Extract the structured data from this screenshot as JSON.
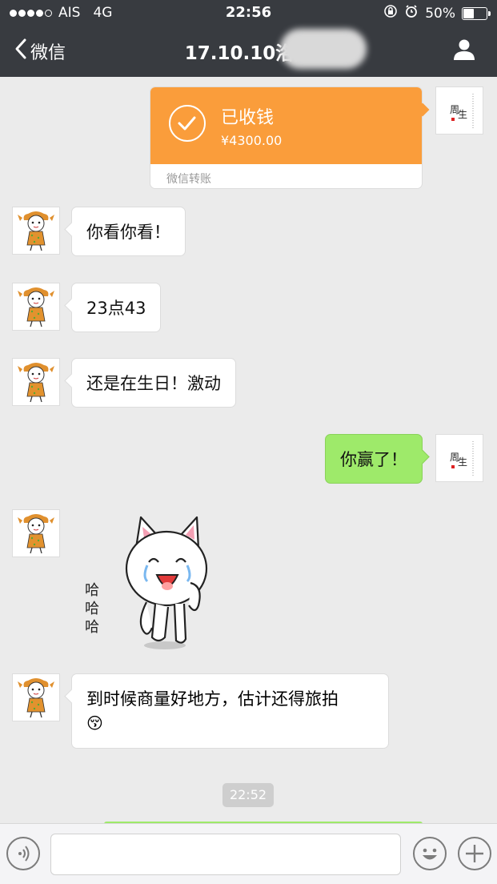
{
  "status_bar": {
    "carrier": "AIS",
    "network": "4G",
    "time": "22:56",
    "battery": "50%",
    "battery_level": 0.5
  },
  "nav": {
    "back_label": "微信",
    "title": "17.10.10洛阳",
    "back_icon": "chevron-left-icon",
    "profile_icon": "person-icon"
  },
  "messages": {
    "transfer": {
      "status": "已收钱",
      "amount": "¥4300.00",
      "footer": "微信转账",
      "color": "#fa9d3b"
    },
    "m1": "你看你看！",
    "m2": "23点43",
    "m3": "还是在生日！激动",
    "m4": "你赢了！",
    "sticker_text": [
      "哈",
      "哈",
      "哈"
    ],
    "m5_line1": "到时候商量好地方，估计还得旅拍",
    "m5_emoji": "😚"
  },
  "timestamp": "22:52",
  "colors": {
    "nav_bg": "#383b40",
    "chat_bg": "#ebebeb",
    "sent_bubble": "#9eea6a",
    "recv_bubble": "#ffffff"
  },
  "input_bar": {
    "voice_icon": "voice-icon",
    "emoji_icon": "smiley-icon",
    "plus_icon": "plus-icon",
    "value": ""
  }
}
